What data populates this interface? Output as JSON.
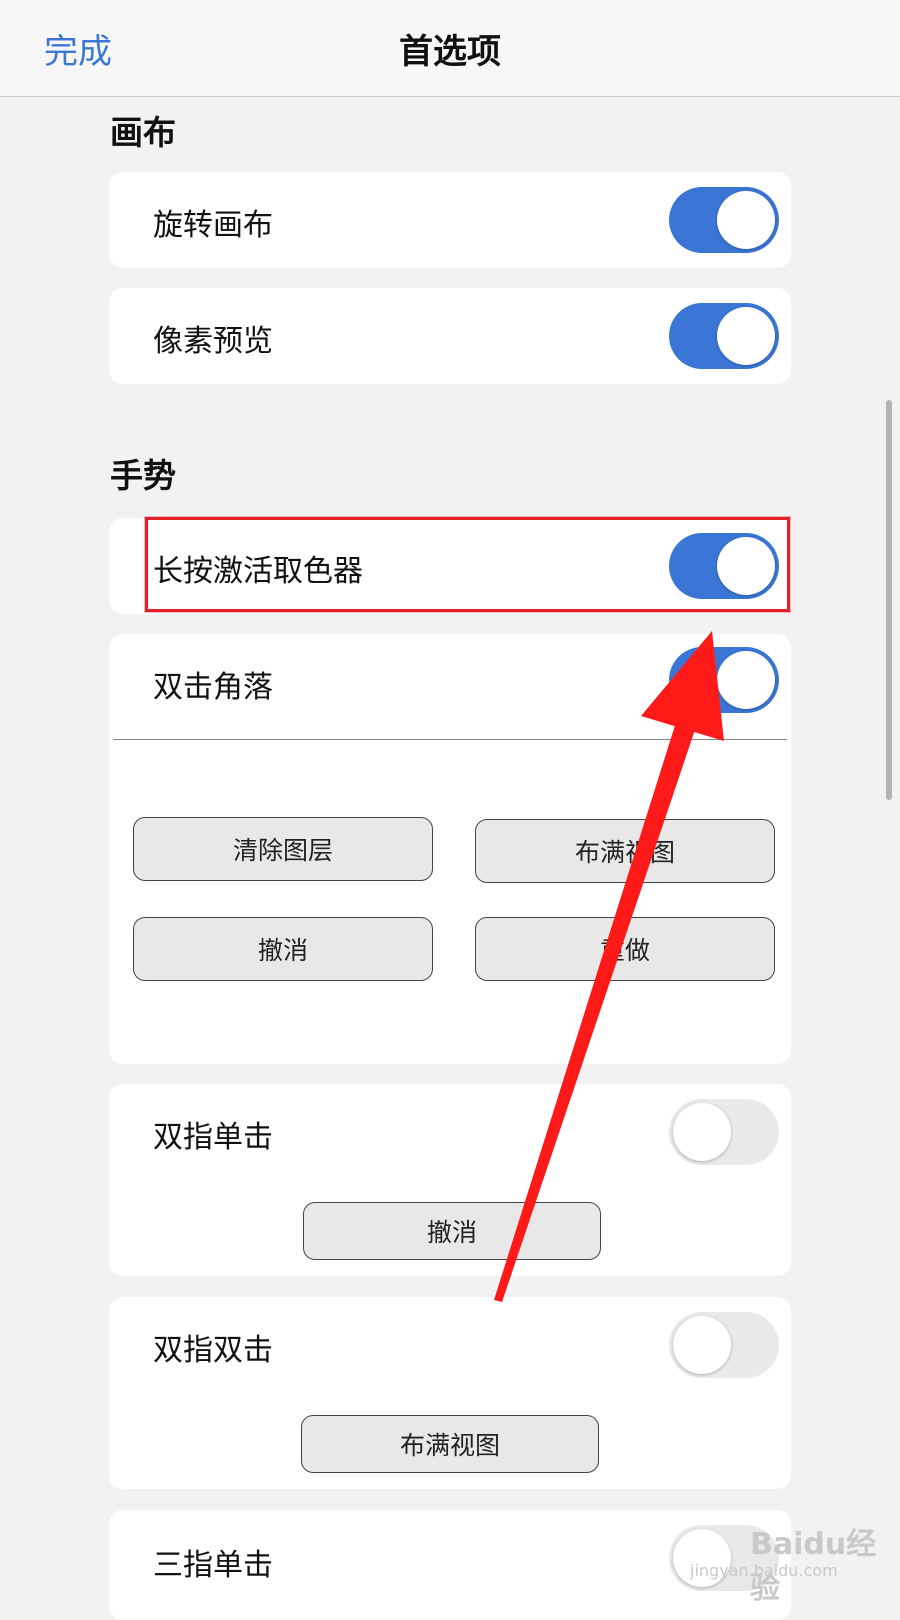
{
  "navbar": {
    "done_label": "完成",
    "title": "首选项"
  },
  "sections": {
    "canvas_title": "画布",
    "gestures_title": "手势"
  },
  "canvas": {
    "rotate_label": "旋转画布",
    "rotate_on": true,
    "pixel_preview_label": "像素预览",
    "pixel_preview_on": true
  },
  "gestures": {
    "long_press_label": "长按激活取色器",
    "long_press_on": true,
    "double_tap_corner_label": "双击角落",
    "double_tap_corner_on": true,
    "corner_buttons": [
      "清除图层",
      "布满视图",
      "撤消",
      "重做"
    ],
    "two_finger_tap_label": "双指单击",
    "two_finger_tap_on": false,
    "two_finger_tap_action": "撤消",
    "two_finger_double_tap_label": "双指双击",
    "two_finger_double_tap_on": false,
    "two_finger_double_tap_action": "布满视图",
    "three_finger_tap_label": "三指单击"
  },
  "watermark": {
    "brand": "Baidu经验",
    "url": "jingyan.baidu.com"
  },
  "colors": {
    "accent": "#3b76d6",
    "highlight": "#e0202a",
    "arrow": "#ff1a1a"
  }
}
